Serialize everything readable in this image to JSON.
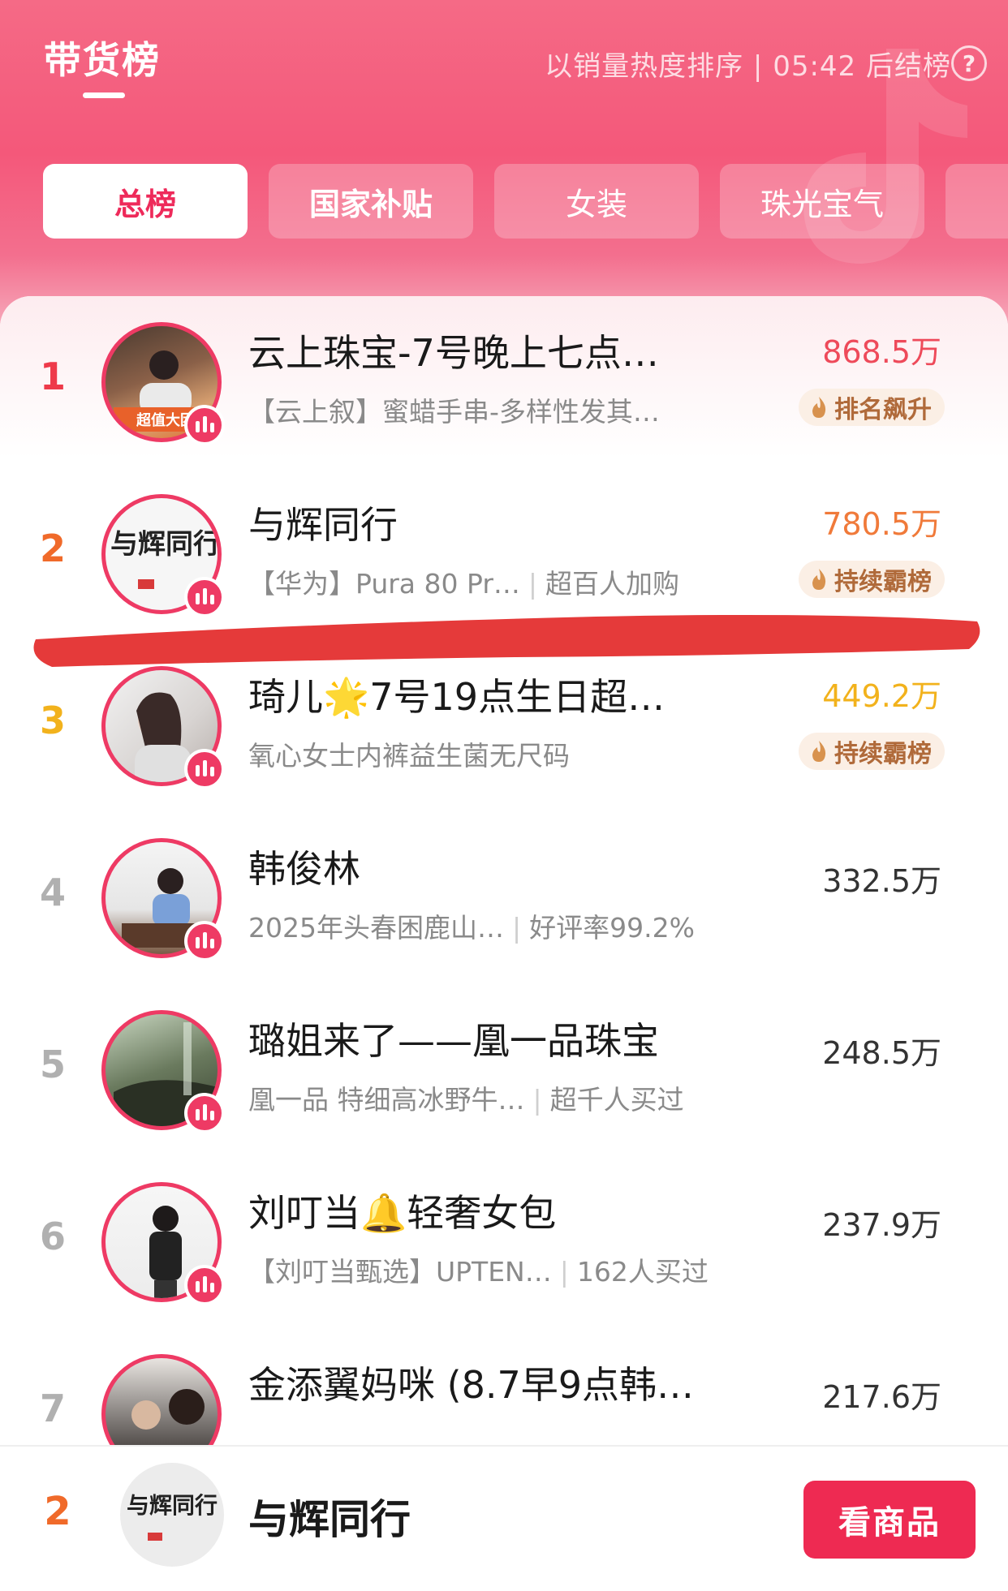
{
  "header": {
    "title": "带货榜",
    "info": "以销量热度排序 | 05:42 后结榜",
    "help_icon": "question-circle-icon"
  },
  "tabs": [
    {
      "label": "总榜",
      "active": true
    },
    {
      "label": "国家补贴",
      "active": false
    },
    {
      "label": "女装",
      "active": false
    },
    {
      "label": "珠光宝气",
      "active": false
    }
  ],
  "colors": {
    "brand_pink": "#ee2a5a",
    "rank_1": "#ee3a4a",
    "rank_2": "#f06a2a",
    "rank_3": "#f2b21c",
    "rank_other": "#b0b0b0",
    "badge_bg": "#fbefe5",
    "annotation_mark": "#e53a3a"
  },
  "rows": [
    {
      "rank": "1",
      "name": "云上珠宝-7号晚上七点…",
      "sub_product": "【云上叙】蜜蜡手串-多样性发其…",
      "sub_extra": "",
      "value": "868.5万",
      "badge": "排名飙升",
      "avatar_text": "超值大团"
    },
    {
      "rank": "2",
      "name": "与辉同行",
      "sub_product": "【华为】Pura 80 Pr…",
      "sub_extra": "超百人加购",
      "value": "780.5万",
      "badge": "持续霸榜",
      "avatar_text": "与辉同行"
    },
    {
      "rank": "3",
      "name": "琦儿🌟7号19点生日超…",
      "sub_product": "氧心女士内裤益生菌无尺码",
      "sub_extra": "",
      "value": "449.2万",
      "badge": "持续霸榜",
      "avatar_text": ""
    },
    {
      "rank": "4",
      "name": "韩俊林",
      "sub_product": "2025年头春困鹿山…",
      "sub_extra": "好评率99.2%",
      "value": "332.5万",
      "badge": "",
      "avatar_text": ""
    },
    {
      "rank": "5",
      "name": "璐姐来了——凰一品珠宝",
      "sub_product": "凰一品 特细高冰野牛…",
      "sub_extra": "超千人买过",
      "value": "248.5万",
      "badge": "",
      "avatar_text": ""
    },
    {
      "rank": "6",
      "name": "刘叮当🔔轻奢女包",
      "sub_product": "【刘叮当甄选】UPTEN…",
      "sub_extra": "162人买过",
      "value": "237.9万",
      "badge": "",
      "avatar_text": ""
    },
    {
      "rank": "7",
      "name": "金添翼妈咪 (8.7早9点韩…",
      "sub_product": "",
      "sub_extra": "",
      "value": "217.6万",
      "badge": "",
      "avatar_text": ""
    }
  ],
  "bottom_bar": {
    "rank": "2",
    "name": "与辉同行",
    "cta_label": "看商品",
    "avatar_text": "与辉同行"
  }
}
